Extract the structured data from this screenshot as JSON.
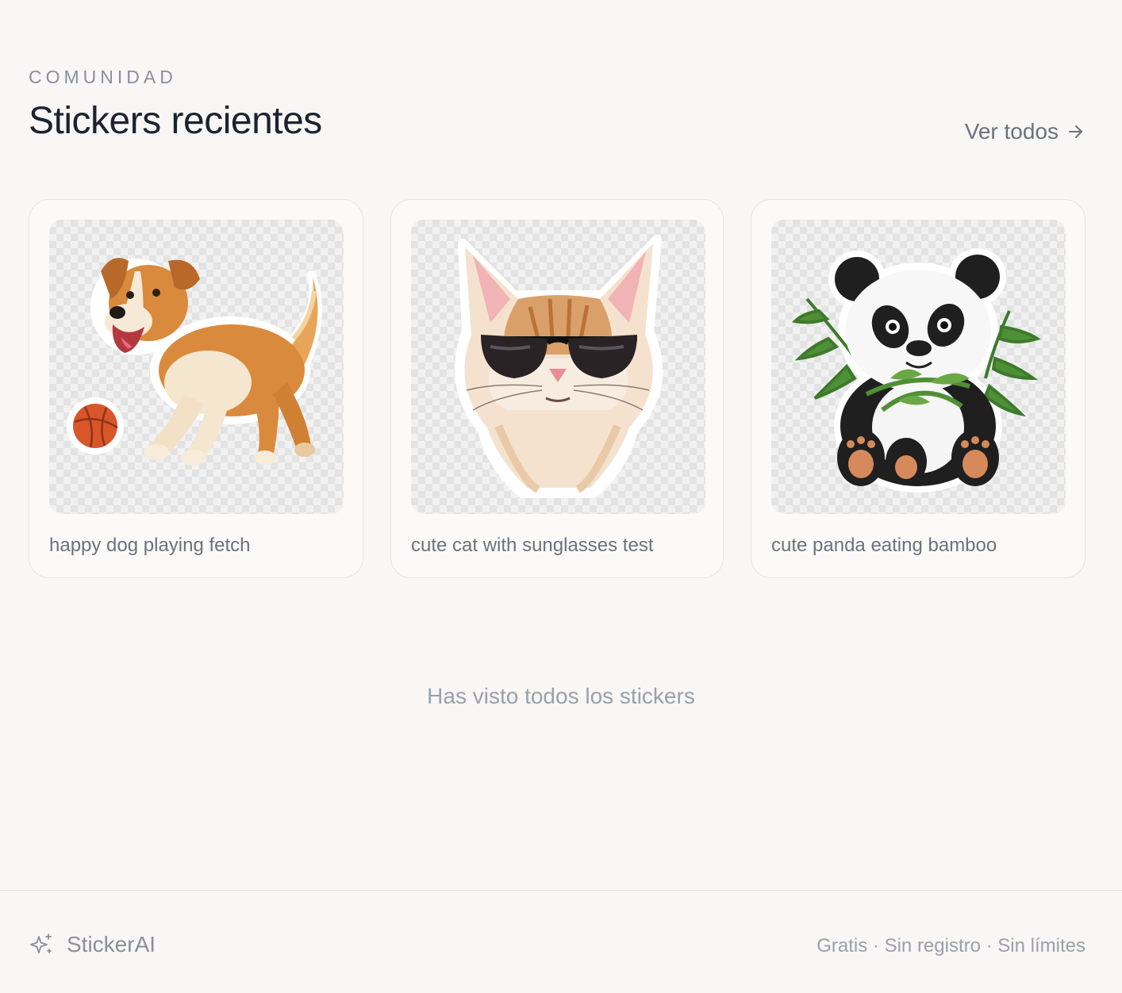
{
  "section": {
    "eyebrow": "COMUNIDAD",
    "title": "Stickers recientes",
    "see_all_label": "Ver todos",
    "see_all_icon": "arrow-right-icon"
  },
  "stickers": [
    {
      "caption": "happy dog playing fetch",
      "image": "dog-sticker"
    },
    {
      "caption": "cute cat with sunglasses test",
      "image": "cat-sticker"
    },
    {
      "caption": "cute panda eating bamboo",
      "image": "panda-sticker"
    }
  ],
  "end_note": "Has visto todos los stickers",
  "footer": {
    "brand_name": "StickerAI",
    "brand_icon": "sparkles-icon",
    "tagline": "Gratis · Sin registro · Sin límites"
  },
  "colors": {
    "background": "#f8f7f5",
    "card_background": "#fbfaf8",
    "card_border": "#e4e3e0",
    "title": "#1c2230",
    "muted_text": "#8a8f99"
  }
}
